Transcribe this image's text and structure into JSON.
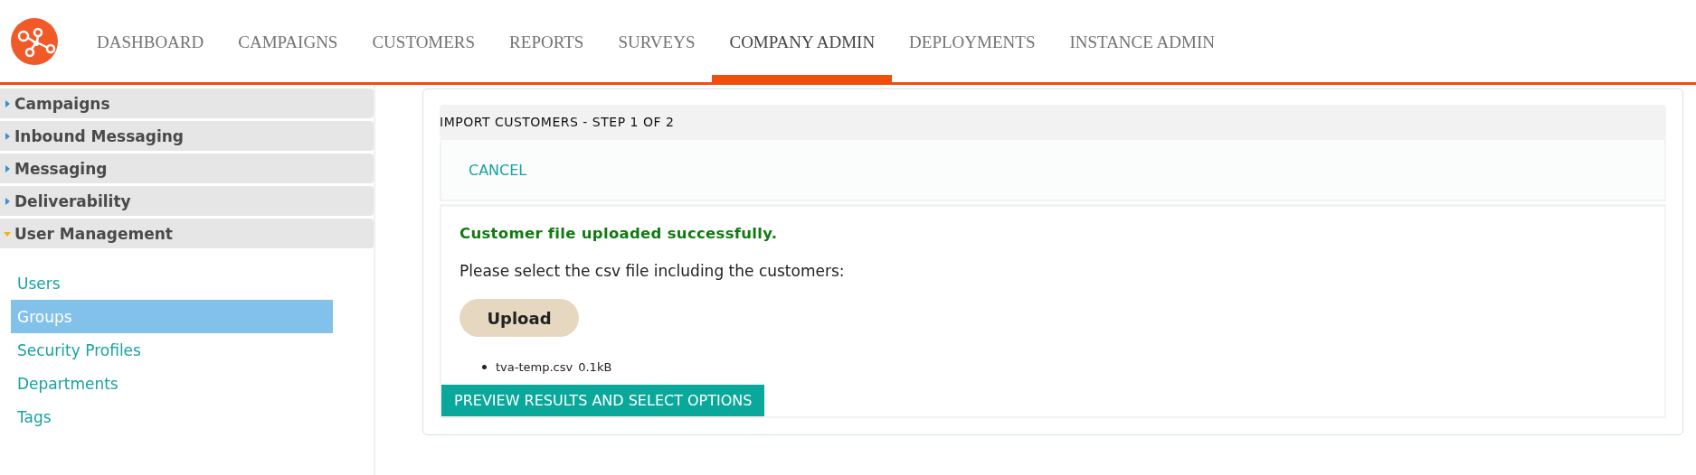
{
  "nav": [
    {
      "label": "DASHBOARD",
      "selected": false
    },
    {
      "label": "CAMPAIGNS",
      "selected": false
    },
    {
      "label": "CUSTOMERS",
      "selected": false
    },
    {
      "label": "REPORTS",
      "selected": false
    },
    {
      "label": "SURVEYS",
      "selected": false
    },
    {
      "label": "COMPANY ADMIN",
      "selected": true
    },
    {
      "label": "DEPLOYMENTS",
      "selected": false
    },
    {
      "label": "INSTANCE ADMIN",
      "selected": false
    }
  ],
  "sidebar": {
    "sections": [
      {
        "label": "Campaigns",
        "expanded": false
      },
      {
        "label": "Inbound Messaging",
        "expanded": false
      },
      {
        "label": "Messaging",
        "expanded": false
      },
      {
        "label": "Deliverability",
        "expanded": false
      },
      {
        "label": "User Management",
        "expanded": true,
        "items": [
          {
            "label": "Users",
            "selected": false
          },
          {
            "label": "Groups",
            "selected": true
          },
          {
            "label": "Security Profiles",
            "selected": false
          },
          {
            "label": "Departments",
            "selected": false
          },
          {
            "label": "Tags",
            "selected": false
          }
        ]
      }
    ]
  },
  "panel": {
    "title": "IMPORT CUSTOMERS - STEP 1 OF 2",
    "cancel": "CANCEL",
    "success": "Customer file uploaded successfully.",
    "prompt": "Please select the csv file including the customers:",
    "upload": "Upload",
    "files": [
      {
        "name": "tva-temp.csv",
        "size": "0.1kB"
      }
    ],
    "submit": "PREVIEW RESULTS AND SELECT OPTIONS"
  }
}
